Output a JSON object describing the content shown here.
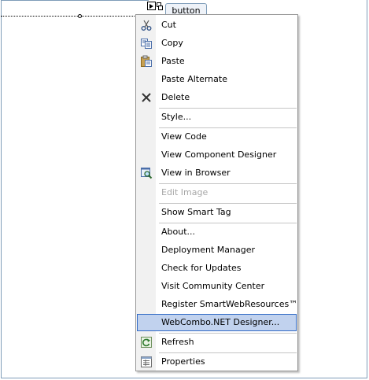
{
  "designer": {
    "button_text": "button"
  },
  "context_menu": {
    "items": [
      {
        "label": "Cut",
        "icon": "scissors-icon",
        "enabled": true
      },
      {
        "label": "Copy",
        "icon": "copy-icon",
        "enabled": true
      },
      {
        "label": "Paste",
        "icon": "paste-icon",
        "enabled": true
      },
      {
        "label": "Paste Alternate",
        "icon": "",
        "enabled": true
      },
      {
        "label": "Delete",
        "icon": "delete-x-icon",
        "enabled": true
      },
      {
        "label": "Style...",
        "icon": "",
        "enabled": true
      },
      {
        "label": "View Code",
        "icon": "",
        "enabled": true
      },
      {
        "label": "View Component Designer",
        "icon": "",
        "enabled": true
      },
      {
        "label": "View in Browser",
        "icon": "browser-magnifier-icon",
        "enabled": true
      },
      {
        "label": "Edit Image",
        "icon": "",
        "enabled": false
      },
      {
        "label": "Show Smart Tag",
        "icon": "",
        "enabled": true
      },
      {
        "label": "About...",
        "icon": "",
        "enabled": true
      },
      {
        "label": "Deployment Manager",
        "icon": "",
        "enabled": true
      },
      {
        "label": "Check for Updates",
        "icon": "",
        "enabled": true
      },
      {
        "label": "Visit Community Center",
        "icon": "",
        "enabled": true
      },
      {
        "label": "Register SmartWebResources™",
        "icon": "",
        "enabled": true
      },
      {
        "label": "WebCombo.NET Designer...",
        "icon": "",
        "enabled": true,
        "highlighted": true
      },
      {
        "label": "Refresh",
        "icon": "refresh-icon",
        "enabled": true
      },
      {
        "label": "Properties",
        "icon": "properties-icon",
        "enabled": true
      }
    ]
  },
  "colors": {
    "highlight_fill": "#c1d2ee",
    "highlight_border": "#316ac5",
    "disabled_text": "#a7a7a7",
    "gutter": "#f1f1f1"
  }
}
